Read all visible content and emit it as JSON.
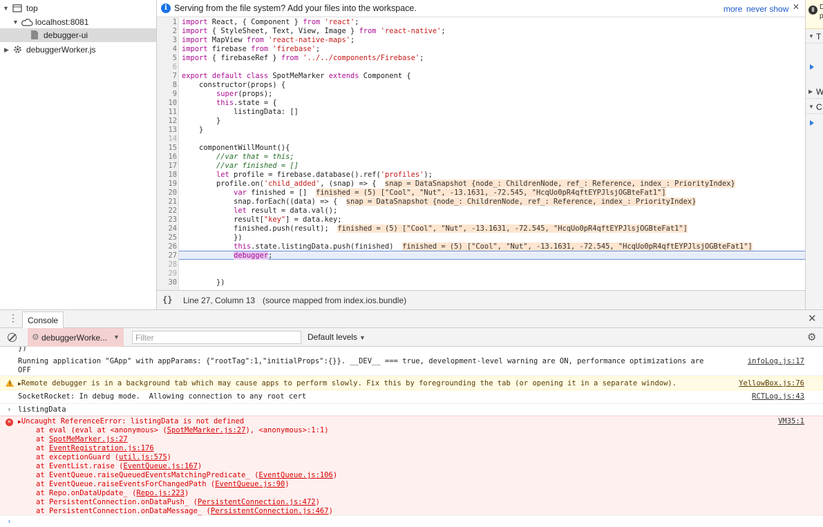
{
  "navigator": {
    "items": [
      {
        "label": "top"
      },
      {
        "label": "localhost:8081"
      },
      {
        "label": "debugger-ui"
      },
      {
        "label": "debuggerWorker.js"
      }
    ]
  },
  "infobar": {
    "message": "Serving from the file system? Add your files into the workspace.",
    "more": "more",
    "never_show": "never show"
  },
  "code": {
    "lines": [
      {
        "n": "1",
        "t": "import React, { Component } from 'react';"
      },
      {
        "n": "2",
        "t": "import { StyleSheet, Text, View, Image } from 'react-native';"
      },
      {
        "n": "3",
        "t": "import MapView from 'react-native-maps';"
      },
      {
        "n": "4",
        "t": "import firebase from 'firebase';"
      },
      {
        "n": "5",
        "t": "import { firebaseRef } from '../../components/Firebase';"
      },
      {
        "n": "6",
        "t": ""
      },
      {
        "n": "7",
        "t": "export default class SpotMeMarker extends Component {"
      },
      {
        "n": "8",
        "t": "    constructor(props) {"
      },
      {
        "n": "9",
        "t": "        super(props);"
      },
      {
        "n": "10",
        "t": "        this.state = {"
      },
      {
        "n": "11",
        "t": "            listingData: []"
      },
      {
        "n": "12",
        "t": "        }"
      },
      {
        "n": "13",
        "t": "    }"
      },
      {
        "n": "14",
        "t": ""
      },
      {
        "n": "15",
        "t": "    componentWillMount(){"
      },
      {
        "n": "16",
        "t": "        //var that = this;"
      },
      {
        "n": "17",
        "t": "        //var finished = []"
      },
      {
        "n": "18",
        "t": "        let profile = firebase.database().ref('profiles');"
      },
      {
        "n": "19",
        "t": "        profile.on('child_added', (snap) => {",
        "inline": "snap = DataSnapshot {node_: ChildrenNode, ref_: Reference, index_: PriorityIndex}"
      },
      {
        "n": "20",
        "t": "            var finished = []",
        "inline": "finished = (5) [\"Cool\", \"Nut\", -13.1631, -72.545, \"HcqUo0pR4qftEYPJlsjOGBteFat1\"]"
      },
      {
        "n": "21",
        "t": "            snap.forEach((data) => {",
        "inline": "snap = DataSnapshot {node_: ChildrenNode, ref_: Reference, index_: PriorityIndex}"
      },
      {
        "n": "22",
        "t": "            let result = data.val();"
      },
      {
        "n": "23",
        "t": "            result[\"key\"] = data.key;"
      },
      {
        "n": "24",
        "t": "            finished.push(result);",
        "inline": "finished = (5) [\"Cool\", \"Nut\", -13.1631, -72.545, \"HcqUo0pR4qftEYPJlsjOGBteFat1\"]"
      },
      {
        "n": "25",
        "t": "            })"
      },
      {
        "n": "26",
        "t": "            this.state.listingData.push(finished)",
        "inline": "finished = (5) [\"Cool\", \"Nut\", -13.1631, -72.545, \"HcqUo0pR4qftEYPJlsjOGBteFat1\"]"
      },
      {
        "n": "27",
        "t": "            debugger;"
      },
      {
        "n": "28",
        "t": ""
      },
      {
        "n": "29",
        "t": ""
      },
      {
        "n": "30",
        "t": "        })"
      }
    ],
    "current_line": 27
  },
  "statusbar": {
    "braces": "{}",
    "position": "Line 27, Column 13",
    "source": "(source mapped from index.ios.bundle)"
  },
  "sidebar": {
    "rows": [
      {
        "label": "T"
      },
      {
        "label": "W"
      },
      {
        "label": "C"
      }
    ],
    "partial_text": "D\np"
  },
  "drawer": {
    "tab_label": "Console"
  },
  "toolbar": {
    "context": "debuggerWorke...",
    "filter_placeholder": "Filter",
    "levels": "Default levels"
  },
  "console": {
    "top_fragment": "})",
    "messages": [
      {
        "text": "Running application \"GApp\" with appParams: {\"rootTag\":1,\"initialProps\":{}}. __DEV__ === true, development-level warning are ON, performance optimizations are",
        "cont": "OFF",
        "source": "infoLog.js:17"
      },
      {
        "text": "Remote debugger is in a background tab which may cause apps to perform slowly. Fix this by foregrounding the tab (or opening it in a separate window).",
        "source": "YellowBox.js:76"
      },
      {
        "text": "SocketRocket: In debug mode.  Allowing connection to any root cert",
        "source": "RCTLog.js:43"
      }
    ],
    "input": "listingData",
    "error": {
      "title": "Uncaught ReferenceError: listingData is not defined",
      "source": "VM35:1",
      "stack": [
        {
          "pre": "at eval (eval at <anonymous> (",
          "link": "SpotMeMarker.js:27",
          "post": "), <anonymous>:1:1)"
        },
        {
          "pre": "at ",
          "link": "SpotMeMarker.js:27",
          "post": ""
        },
        {
          "pre": "at ",
          "link": "EventRegistration.js:176",
          "post": ""
        },
        {
          "pre": "at exceptionGuard (",
          "link": "util.js:575",
          "post": ")"
        },
        {
          "pre": "at EventList.raise (",
          "link": "EventQueue.js:167",
          "post": ")"
        },
        {
          "pre": "at EventQueue.raiseQueuedEventsMatchingPredicate_ (",
          "link": "EventQueue.js:106",
          "post": ")"
        },
        {
          "pre": "at EventQueue.raiseEventsForChangedPath (",
          "link": "EventQueue.js:90",
          "post": ")"
        },
        {
          "pre": "at Repo.onDataUpdate_ (",
          "link": "Repo.js:223",
          "post": ")"
        },
        {
          "pre": "at PersistentConnection.onDataPush_ (",
          "link": "PersistentConnection.js:472",
          "post": ")"
        },
        {
          "pre": "at PersistentConnection.onDataMessage_ (",
          "link": "PersistentConnection.js:467",
          "post": ")"
        }
      ]
    },
    "prompt_symbol": "›"
  }
}
